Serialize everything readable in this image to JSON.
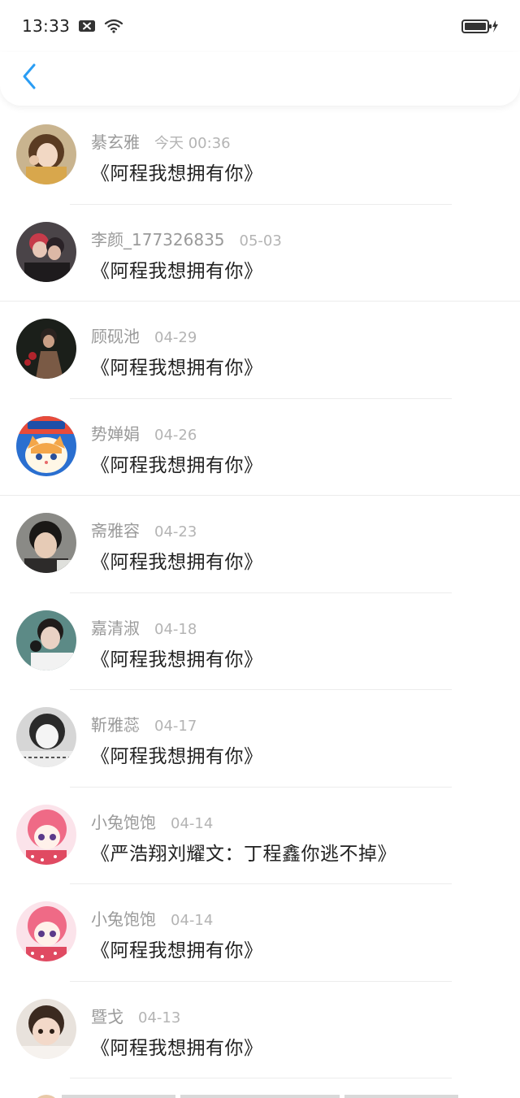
{
  "status_bar": {
    "time": "13:33",
    "icons": [
      "notification-x-icon",
      "wifi-icon",
      "battery-charging-icon"
    ]
  },
  "header": {
    "back_icon": "chevron-left-icon",
    "accent_color": "#2a9df4"
  },
  "items": [
    {
      "name": "綦玄雅",
      "date": "今天 00:36",
      "title": "《阿程我想拥有你》",
      "avatar": "girl-selfie"
    },
    {
      "name": "李颜_177326835",
      "date": "05-03",
      "title": "《阿程我想拥有你》",
      "avatar": "couple-red"
    },
    {
      "name": "顾砚池",
      "date": "04-29",
      "title": "《阿程我想拥有你》",
      "avatar": "boy-dark-roses"
    },
    {
      "name": "势婵娟",
      "date": "04-26",
      "title": "《阿程我想拥有你》",
      "avatar": "cartoon-cat-goodnight"
    },
    {
      "name": "斋雅容",
      "date": "04-23",
      "title": "《阿程我想拥有你》",
      "avatar": "boy-headphones"
    },
    {
      "name": "嘉清淑",
      "date": "04-18",
      "title": "《阿程我想拥有你》",
      "avatar": "boy-microphone"
    },
    {
      "name": "靳雅蕊",
      "date": "04-17",
      "title": "《阿程我想拥有你》",
      "avatar": "girl-bw-sketch"
    },
    {
      "name": "小兔饱饱",
      "date": "04-14",
      "title": "《严浩翔刘耀文：丁程鑫你逃不掉》",
      "avatar": "anime-pink-girl"
    },
    {
      "name": "小兔饱饱",
      "date": "04-14",
      "title": "《阿程我想拥有你》",
      "avatar": "anime-pink-girl"
    },
    {
      "name": "暨戈",
      "date": "04-13",
      "title": "《阿程我想拥有你》",
      "avatar": "toddler-photo"
    }
  ]
}
